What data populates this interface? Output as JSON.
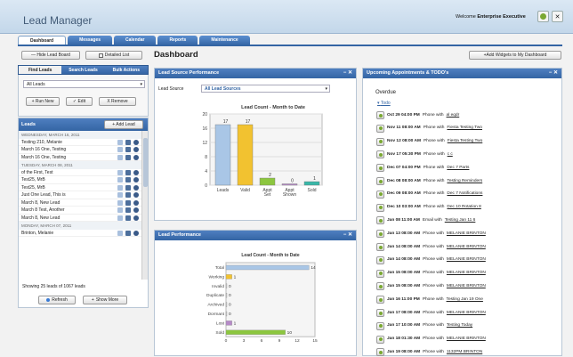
{
  "header": {
    "app_title": "Lead Manager",
    "welcome_prefix": "Welcome",
    "welcome_user": "Enterprise Executive"
  },
  "nav": {
    "tabs": [
      "Dashboard",
      "Messages",
      "Calendar",
      "Reports",
      "Maintenance"
    ],
    "active": "Dashboard"
  },
  "toolbar": {
    "hide_lead_board": "— Hide Lead Board",
    "detailed_list": "Detailed List",
    "add_widgets": "+Add Widgets to My Dashboard"
  },
  "page_title": "Dashboard",
  "lead_search": {
    "tabs": [
      "Find Leads",
      "Search Leads",
      "Bulk Actions"
    ],
    "filter_value": "All Leads",
    "buttons": [
      "+ Run New",
      "✓ Edit",
      "X Remove"
    ]
  },
  "leads_panel": {
    "title": "Leads",
    "add_lead": "+ Add Lead",
    "groups": [
      {
        "date": "WEDNESDAY, MARCH 16, 2011",
        "items": [
          "Testing 210, Melanie",
          "March 16 One, Testing",
          "March 16 One, Testing"
        ]
      },
      {
        "date": "TUESDAY, MARCH 08, 2011",
        "items": [
          "of the First, Test",
          "Test25, MrB",
          "Test25, MrB",
          "Just One Lead, This is",
          "March 8, New Lead",
          "March 8 Test, Another",
          "March 8, New Lead"
        ]
      },
      {
        "date": "MONDAY, MARCH 07, 2011",
        "items": [
          "Brinton, Melanie"
        ]
      }
    ],
    "showing": "Showing 25 leads of 1067 leads",
    "refresh": "Refresh",
    "show_more": "Show More"
  },
  "lead_source": {
    "panel_title": "Lead Source Performance",
    "label": "Lead Source",
    "select_value": "All Lead Sources"
  },
  "lead_performance": {
    "panel_title": "Lead Performance"
  },
  "appointments": {
    "panel_title": "Upcoming Appointments & TODO's",
    "overdue_label": "Overdue",
    "todo_label": "Todo",
    "items": [
      {
        "when": "Oct 29 04:00 PM",
        "via": "Phone with",
        "who": "al eqdr"
      },
      {
        "when": "Nov 11 08:00 AM",
        "via": "Phone with",
        "who": "Fiesta Testing Two"
      },
      {
        "when": "Nov 12 08:00 AM",
        "via": "Phone with",
        "who": "Fiesta Testing Two"
      },
      {
        "when": "Nov 17 05:30 PM",
        "via": "Phone with",
        "who": "c c"
      },
      {
        "when": "Dec 07 04:00 PM",
        "via": "Phone with",
        "who": "Dec 7 Parts"
      },
      {
        "when": "Dec 08 08:00 AM",
        "via": "Phone with",
        "who": "Testing Reminders"
      },
      {
        "when": "Dec 09 08:00 AM",
        "via": "Phone with",
        "who": "Dec 7 Notifications"
      },
      {
        "when": "Dec 10 03:00 AM",
        "via": "Phone with",
        "who": "Dec 10 Rotation 8"
      },
      {
        "when": "Jan 08 11:00 AM",
        "via": "Email with",
        "who": "Testing Jan 11 6"
      },
      {
        "when": "Jan 13 08:00 AM",
        "via": "Phone with",
        "who": "MELANIE BRINTON"
      },
      {
        "when": "Jan 14 08:00 AM",
        "via": "Phone with",
        "who": "MELANIE BRINTON"
      },
      {
        "when": "Jan 14 08:00 AM",
        "via": "Phone with",
        "who": "MELANIE BRINTON"
      },
      {
        "when": "Jan 15 08:00 AM",
        "via": "Phone with",
        "who": "MELANIE BRINTON"
      },
      {
        "when": "Jan 15 08:00 AM",
        "via": "Phone with",
        "who": "MELANIE BRINTON"
      },
      {
        "when": "Jan 16 11:00 PM",
        "via": "Phone with",
        "who": "Testing Jan 19 One"
      },
      {
        "when": "Jan 17 08:00 AM",
        "via": "Phone with",
        "who": "MELANIE BRINTON"
      },
      {
        "when": "Jan 17 10:00 AM",
        "via": "Phone with",
        "who": "Testing Today"
      },
      {
        "when": "Jan 18 01:30 AM",
        "via": "Phone with",
        "who": "MELANIE BRINTON"
      },
      {
        "when": "Jan 19 08:00 AM",
        "via": "Phone with",
        "who": "1132PM BRINTON"
      }
    ]
  },
  "chart_data": [
    {
      "type": "bar",
      "title": "Lead Count - Month to Date",
      "categories": [
        "Leads",
        "Valid",
        "Appt Set",
        "Appt Shown",
        "Sold"
      ],
      "values": [
        17,
        17,
        2,
        0,
        1
      ],
      "ylim": [
        0,
        20
      ],
      "yticks": [
        0,
        4,
        8,
        12,
        16,
        20
      ],
      "grid": true,
      "colors": [
        "#a9c6e6",
        "#f2c230",
        "#8cc63f",
        "#b68ac8",
        "#38b7a8"
      ]
    },
    {
      "type": "bar",
      "orientation": "horizontal",
      "title": "Lead Count - Month to Date",
      "categories": [
        "Total",
        "Working",
        "Invalid",
        "Duplicate",
        "Archived",
        "Dormant",
        "Lost",
        "Sold"
      ],
      "values": [
        14,
        1,
        0,
        0,
        0,
        0,
        1,
        10
      ],
      "xlim": [
        0,
        15
      ],
      "xticks": [
        0,
        3,
        6,
        9,
        12,
        15
      ],
      "colors": [
        "#a9c6e6",
        "#f2c230",
        "#cccccc",
        "#cccccc",
        "#cccccc",
        "#cccccc",
        "#b68ac8",
        "#8cc63f"
      ]
    }
  ]
}
